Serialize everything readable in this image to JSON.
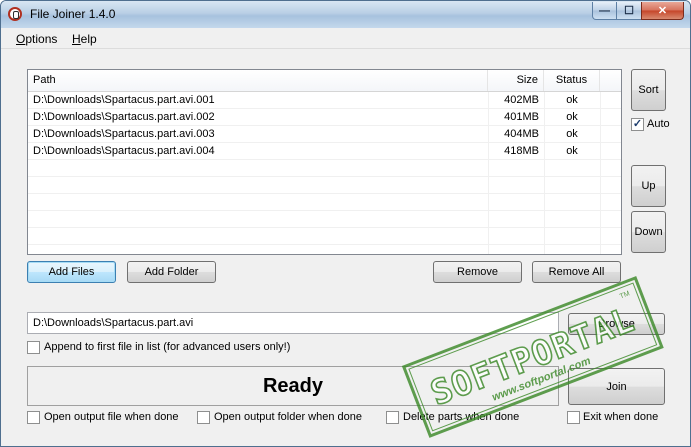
{
  "window": {
    "title": "File Joiner 1.4.0",
    "controls": {
      "minimize": "—",
      "maximize": "☐",
      "close": "✕"
    }
  },
  "menu": [
    {
      "label": "Options",
      "mnemonic": "O",
      "rest": "ptions"
    },
    {
      "label": "Help",
      "mnemonic": "H",
      "rest": "elp"
    }
  ],
  "file_list": {
    "columns": {
      "path": "Path",
      "size": "Size",
      "status": "Status"
    },
    "rows": [
      {
        "path": "D:\\Downloads\\Spartacus.part.avi.001",
        "size": "402MB",
        "status": "ok"
      },
      {
        "path": "D:\\Downloads\\Spartacus.part.avi.002",
        "size": "401MB",
        "status": "ok"
      },
      {
        "path": "D:\\Downloads\\Spartacus.part.avi.003",
        "size": "404MB",
        "status": "ok"
      },
      {
        "path": "D:\\Downloads\\Spartacus.part.avi.004",
        "size": "418MB",
        "status": "ok"
      }
    ]
  },
  "side_buttons": {
    "sort": "Sort",
    "auto_label": "Auto",
    "auto_checked": true,
    "up": "Up",
    "down": "Down"
  },
  "list_buttons": {
    "add_files": "Add Files",
    "add_folder": "Add Folder",
    "remove": "Remove",
    "remove_all": "Remove All"
  },
  "output": {
    "path": "D:\\Downloads\\Spartacus.part.avi",
    "browse": "Browse",
    "append_label": "Append to first file in list (for advanced users only!)",
    "append_checked": false
  },
  "status": {
    "text": "Ready"
  },
  "join_button": "Join",
  "options": {
    "open_file": "Open output file when done",
    "open_folder": "Open output folder when done",
    "delete_parts": "Delete parts when done",
    "exit_when_done": "Exit when done"
  },
  "watermark": {
    "brand": "SOFTPORTAL",
    "tm": "TM",
    "url": "www.softportal.com",
    "color": "#3d8a2a"
  }
}
